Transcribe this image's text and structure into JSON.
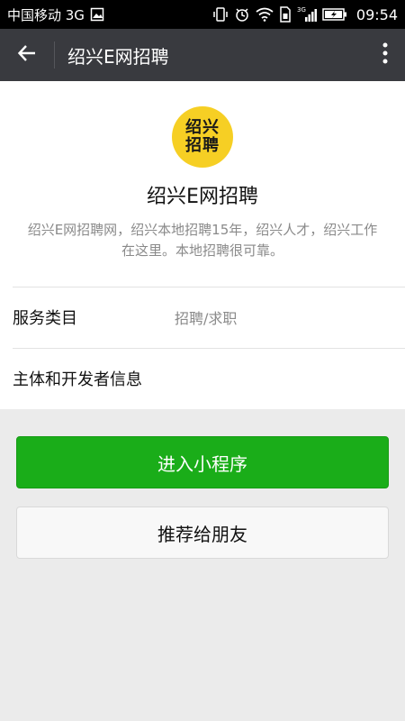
{
  "statusbar": {
    "carrier": "中国移动 3G",
    "network": "3G",
    "time": "09:54"
  },
  "appbar": {
    "title": "绍兴E网招聘"
  },
  "app": {
    "logo_line1": "绍兴",
    "logo_line2": "招聘",
    "logo_color": "#f6cf24",
    "name": "绍兴E网招聘",
    "description": "绍兴E网招聘网，绍兴本地招聘15年，绍兴人才，绍兴工作在这里。本地招聘很可靠。"
  },
  "rows": [
    {
      "label": "服务类目",
      "value": "招聘/求职"
    },
    {
      "label": "主体和开发者信息",
      "value": ""
    }
  ],
  "buttons": {
    "enter": "进入小程序",
    "recommend": "推荐给朋友"
  },
  "colors": {
    "appbar": "#393a3f",
    "primary": "#1aad19"
  }
}
